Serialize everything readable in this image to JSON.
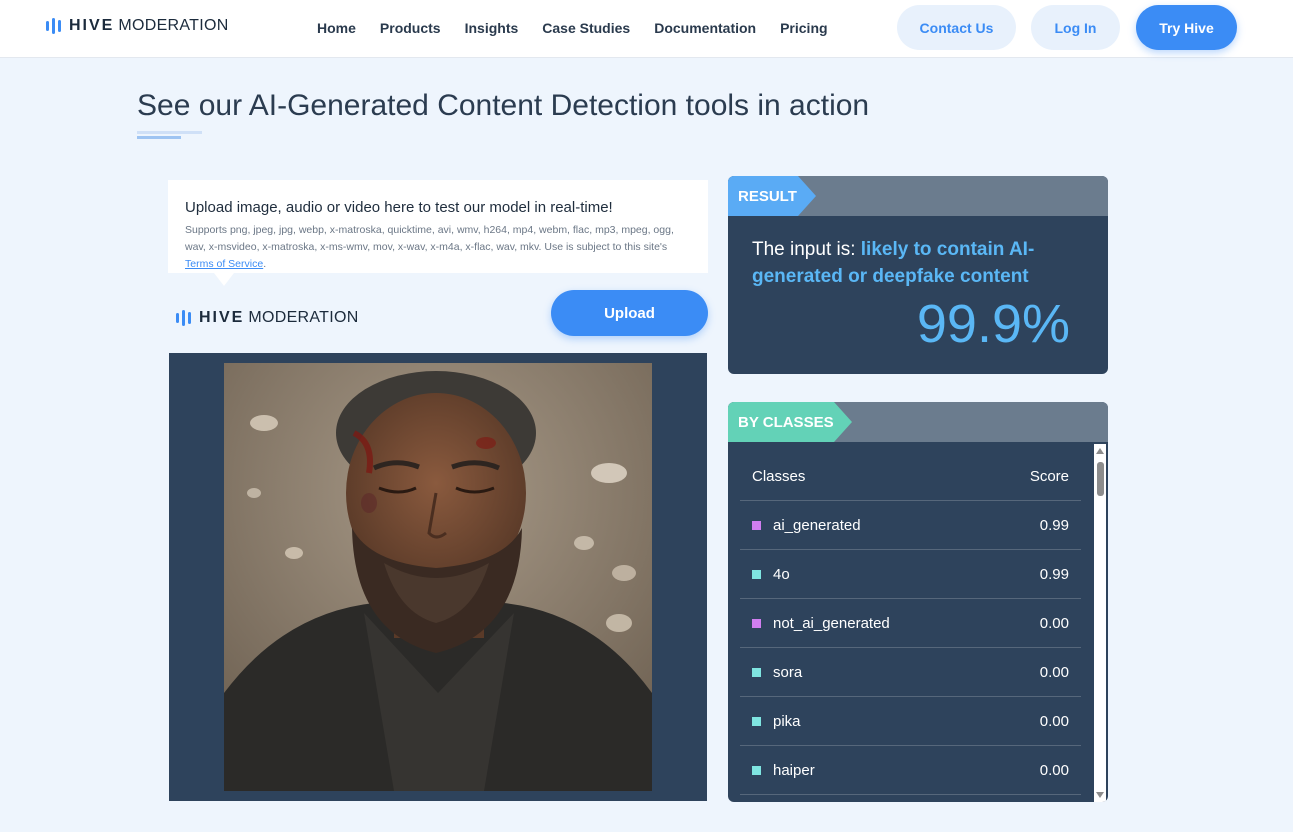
{
  "header": {
    "logo_hive": "HIVE",
    "logo_moderation": "MODERATION",
    "nav": [
      "Home",
      "Products",
      "Insights",
      "Case Studies",
      "Documentation",
      "Pricing"
    ],
    "contact_label": "Contact Us",
    "login_label": "Log In",
    "try_label": "Try Hive"
  },
  "title": "See our AI-Generated Content Detection tools in action",
  "upload": {
    "heading": "Upload image, audio or video here to test our model in real-time!",
    "supports": "Supports png, jpeg, jpg, webp, x-matroska, quicktime, avi, wmv, h264, mp4, webm, flac, mp3, mpeg, ogg, wav, x-msvideo, x-matroska, x-ms-wmv, mov, x-wav, x-m4a, x-flac, wav, mkv. Use is subject to this site's",
    "tos_link": "Terms of Service",
    "button_label": "Upload",
    "logo_hive": "HIVE",
    "logo_moderation": "MODERATION"
  },
  "result": {
    "tag": "RESULT",
    "prefix": "The input is: ",
    "verdict": "likely to contain AI-generated or deepfake content",
    "score": "99.9%"
  },
  "classes": {
    "tag": "BY CLASSES",
    "col_class": "Classes",
    "col_score": "Score",
    "rows": [
      {
        "name": "ai_generated",
        "score": "0.99",
        "color": "#d07ef0"
      },
      {
        "name": "4o",
        "score": "0.99",
        "color": "#7fe5e1"
      },
      {
        "name": "not_ai_generated",
        "score": "0.00",
        "color": "#d07ef0"
      },
      {
        "name": "sora",
        "score": "0.00",
        "color": "#7fe5e1"
      },
      {
        "name": "pika",
        "score": "0.00",
        "color": "#7fe5e1"
      },
      {
        "name": "haiper",
        "score": "0.00",
        "color": "#7fe5e1"
      }
    ]
  },
  "colors": {
    "accent": "#3b8cf5",
    "panel": "#2e435c",
    "result_tag": "#5aabf5",
    "classes_tag": "#63d2b7"
  }
}
